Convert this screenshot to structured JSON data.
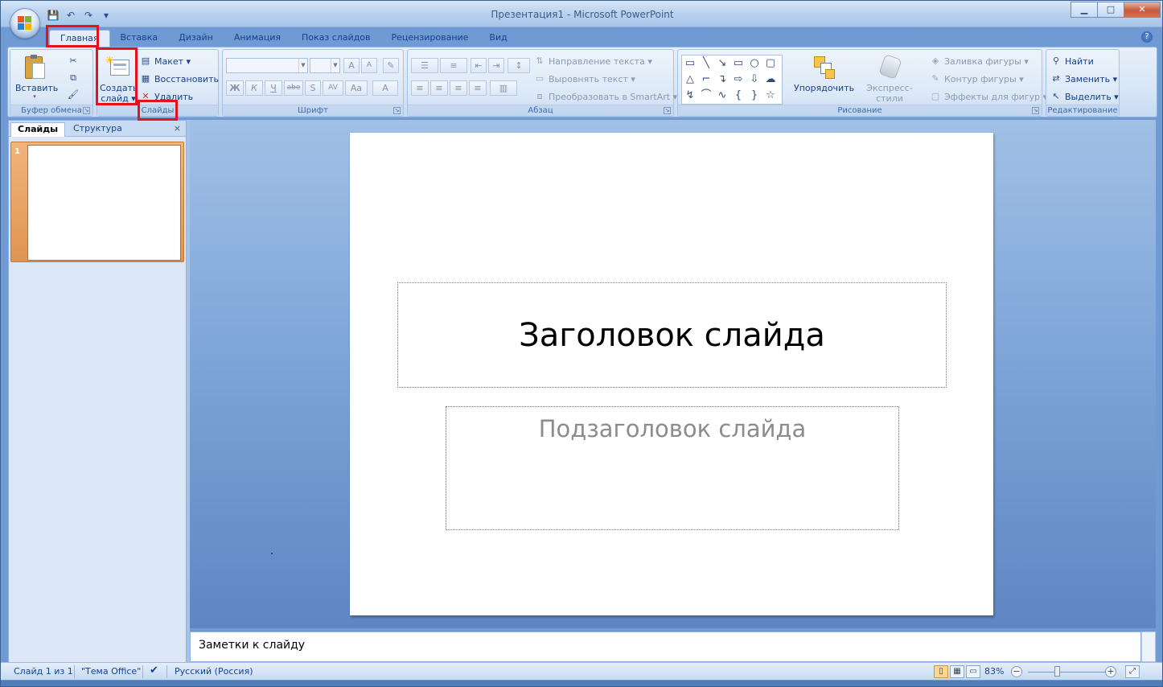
{
  "window": {
    "title": "Презентация1 - Microsoft PowerPoint",
    "controls": {
      "minimize": "▁",
      "maximize": "□",
      "close": "✕"
    }
  },
  "quick_access": {
    "save": "💾",
    "undo": "↶",
    "redo": "↷",
    "customize": "▾"
  },
  "tabs": [
    "Главная",
    "Вставка",
    "Дизайн",
    "Анимация",
    "Показ слайдов",
    "Рецензирование",
    "Вид"
  ],
  "help": "?",
  "ribbon": {
    "clipboard": {
      "label": "Буфер обмена",
      "paste": "Вставить",
      "paste_arrow": "▾"
    },
    "slides": {
      "label": "Слайды",
      "new_slide_line1": "Создать",
      "new_slide_line2": "слайд ▾",
      "layout": "Макет ▾",
      "reset": "Восстановить",
      "delete": "Удалить"
    },
    "font": {
      "label": "Шрифт",
      "buttons": [
        "Ж",
        "К",
        "Ч",
        "abe",
        "S",
        "AV",
        "Aa",
        "A"
      ],
      "grow": "A",
      "shrink": "A"
    },
    "paragraph": {
      "label": "Абзац",
      "text_direction": "Направление текста ▾",
      "align_text": "Выровнять текст ▾",
      "smartart": "Преобразовать в SmartArt ▾"
    },
    "drawing": {
      "label": "Рисование",
      "arrange": "Упорядочить",
      "quick_styles": "Экспресс-стили",
      "shape_fill": "Заливка фигуры ▾",
      "shape_outline": "Контур фигуры ▾",
      "shape_effects": "Эффекты для фигур ▾",
      "shapes": [
        "▭",
        "╲",
        "↘",
        "▭",
        "○",
        "▢",
        "△",
        "⌐",
        "↴",
        "⇨",
        "⇩",
        "☁",
        "↯",
        "⌒",
        "∿",
        "{",
        "}",
        "☆"
      ]
    },
    "editing": {
      "label": "Редактирование",
      "find": "Найти",
      "replace": "Заменить ▾",
      "select": "Выделить ▾"
    }
  },
  "left_pane": {
    "tab_slides": "Слайды",
    "tab_outline": "Структура",
    "close": "×",
    "thumb_number": "1"
  },
  "slide": {
    "title_placeholder": "Заголовок слайда",
    "subtitle_placeholder": "Подзаголовок слайда"
  },
  "notes": {
    "placeholder": "Заметки к слайду"
  },
  "status": {
    "slide_info": "Слайд 1 из 1",
    "theme": "\"Тема Office\"",
    "language": "Русский (Россия)",
    "zoom": "83%",
    "zoom_level_percent": 83
  }
}
